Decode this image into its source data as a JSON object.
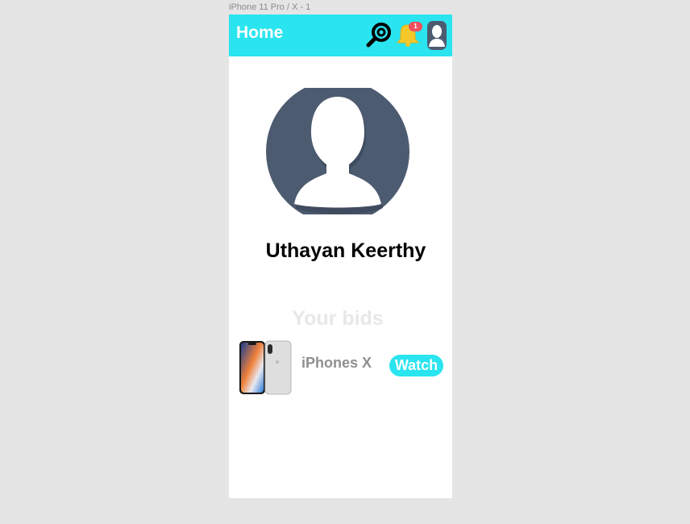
{
  "artboard": {
    "label": "iPhone 11 Pro / X - 1"
  },
  "app_bar": {
    "title": "Home",
    "search_icon": "magnifier-icon",
    "notification_icon": "bell-icon",
    "notification_count": "1",
    "avatar_icon": "user-avatar-icon"
  },
  "profile": {
    "name": "Uthayan Keerthy",
    "avatar_icon": "person-silhouette-icon"
  },
  "bids": {
    "title": "Your bids",
    "items": [
      {
        "name": "iPhones X",
        "action_label": "Watch",
        "thumb_icon": "iphone-x-image"
      }
    ]
  },
  "colors": {
    "accent": "#2ae4ef",
    "avatar_bg": "#4d5b70",
    "bell": "#f4c82b",
    "badge": "#ef4f5f"
  }
}
